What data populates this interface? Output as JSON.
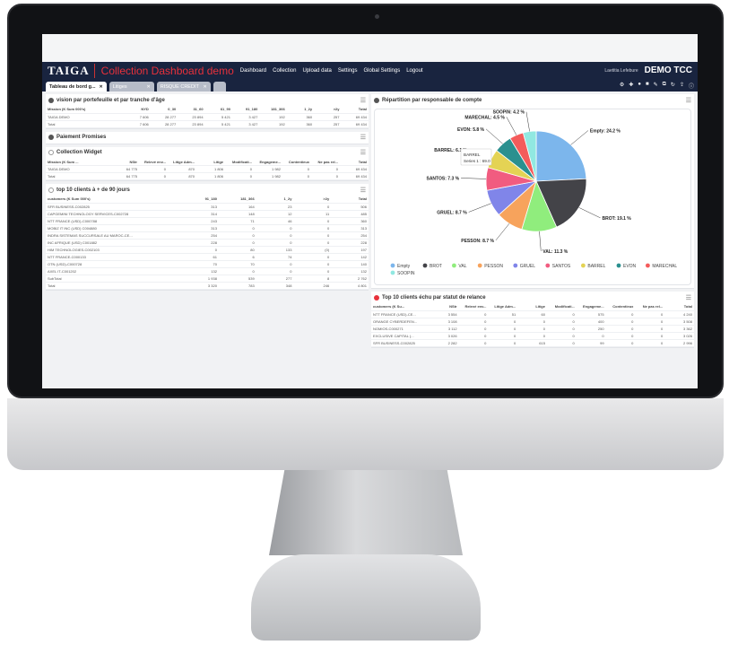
{
  "brand": "TAIGA",
  "app_title": "Collection Dashboard demo",
  "nav": [
    "Dashboard",
    "Collection",
    "Upload data",
    "Settings",
    "Global Settings",
    "Logout"
  ],
  "user": "Laetitia Lefebure",
  "company": "DEMO TCC",
  "tabs": [
    {
      "label": "Tableau de bord g...",
      "state": "active"
    },
    {
      "label": "Litiges",
      "state": "inactive"
    },
    {
      "label": "RISQUE CREDIT",
      "state": "inactive"
    }
  ],
  "colors": {
    "navy": "#19243f",
    "accent": "#e8313b"
  },
  "w1": {
    "title": "vision par portefeuille et par tranche d'âge",
    "headers": [
      "Mission (K Sum 000's)",
      "NYD",
      "0_30",
      "31_60",
      "61_90",
      "91_180",
      "181_366",
      "1_2y",
      ">2y",
      "Total"
    ],
    "rows": [
      [
        "TAIGA DEMO",
        "7 606",
        "28 277",
        "23 894",
        "5 421",
        "3 427",
        "192",
        "360",
        "257",
        "69 434"
      ],
      [
        "Total",
        "7 606",
        "28 277",
        "23 894",
        "5 421",
        "3 427",
        "192",
        "360",
        "257",
        "69 434"
      ]
    ]
  },
  "w2": {
    "title": "Paiement Promises"
  },
  "w3": {
    "title": "Collection Widget",
    "headers": [
      "Mission (K Sum ...",
      "NStr",
      "Relevé env...",
      "Litige Adm...",
      "Litige",
      "Modificati...",
      "Engageme...",
      "Contentieux",
      "Ne pas rel...",
      "Total"
    ],
    "rows": [
      [
        "TAIGA DEMO",
        "64 775",
        "0",
        "870",
        "1 806",
        "0",
        "1 982",
        "0",
        "0",
        "69 434"
      ],
      [
        "Total",
        "64 775",
        "0",
        "870",
        "1 806",
        "0",
        "1 982",
        "0",
        "0",
        "69 434"
      ]
    ]
  },
  "w4": {
    "title": "top 10 clients à + de 90 jours",
    "headers": [
      "customers (K Sum 000's)",
      "91_180",
      "181_366",
      "1_2y",
      ">2y",
      "Total"
    ],
    "rows": [
      [
        "SFR BUSINESS-C002825",
        "313",
        "164",
        "23",
        "0",
        "506"
      ],
      [
        "CAPGEMINI TECHNOLOGY SERVICES-C002728",
        "314",
        "148",
        "12",
        "11",
        "485"
      ],
      [
        "NTT FRANCE (USD)-C000788",
        "243",
        "71",
        "46",
        "0",
        "360"
      ],
      [
        "MOBIZ IT INC (USD) C004880",
        "313",
        "0",
        "0",
        "0",
        "313"
      ],
      [
        "INDRA SISTEMAS SUCCURSALE AU MAROC-CE...",
        "254",
        "0",
        "0",
        "0",
        "254"
      ],
      [
        "INC AFRIQUE (USD) C001882",
        "228",
        "0",
        "0",
        "0",
        "228"
      ],
      [
        "HIM TECHNOLOGIES-C002103",
        "0",
        "80",
        "133",
        "(0)",
        "197"
      ],
      [
        "NTT FRANCE-C000133",
        "61",
        "6",
        "74",
        "0",
        "142"
      ],
      [
        "OTN (USD)-C000728",
        "70",
        "70",
        "0",
        "0",
        "140"
      ],
      [
        "AXEL IT-C001202",
        "132",
        "0",
        "0",
        "0",
        "132"
      ],
      [
        "SubTotal",
        "1 938",
        "539",
        "277",
        "8",
        "2 762"
      ],
      [
        "Total",
        "3 320",
        "783",
        "348",
        "246",
        "4 801"
      ]
    ]
  },
  "w5": {
    "title": "Répartition par responsable de compte",
    "tooltip": {
      "name": "BARREL",
      "line": "Series 1 : 69.0"
    },
    "legend_title": ""
  },
  "chart_data": {
    "type": "pie",
    "title": "Répartition par responsable de compte",
    "slices": [
      {
        "label": "Empty",
        "percent": 24.2,
        "color": "#7cb6ec"
      },
      {
        "label": "BROT",
        "percent": 19.1,
        "color": "#434348"
      },
      {
        "label": "VAL",
        "percent": 11.3,
        "color": "#90ed7d"
      },
      {
        "label": "PESSON",
        "percent": 8.7,
        "color": "#f7a35c"
      },
      {
        "label": "GRUEL",
        "percent": 8.7,
        "color": "#8085e9"
      },
      {
        "label": "SANTOS",
        "percent": 7.3,
        "color": "#f15c80"
      },
      {
        "label": "BARREL",
        "percent": 6.1,
        "color": "#e4d354"
      },
      {
        "label": "EVON",
        "percent": 5.8,
        "color": "#2b908f"
      },
      {
        "label": "MARECHAL",
        "percent": 4.5,
        "color": "#f45b5b"
      },
      {
        "label": "SOOPIN",
        "percent": 4.2,
        "color": "#91e8e1"
      }
    ],
    "legend_placement": "bottom"
  },
  "w6": {
    "title": "Top 10 clients échu par statut de relance",
    "headers": [
      "customers (K Su...",
      "NStr",
      "Relevé env...",
      "Litige Adm...",
      "Litige",
      "Modificati...",
      "Engageme...",
      "Contentieux",
      "Ne pas rel...",
      "Total"
    ],
    "rows": [
      [
        "NTT FRANCE (USD)-CE...",
        "3 554",
        "0",
        "51",
        "60",
        "0",
        "575",
        "0",
        "0",
        "4 240"
      ],
      [
        "ORANGE CYBERDEFEN...",
        "3 108",
        "0",
        "0",
        "0",
        "0",
        "400",
        "0",
        "0",
        "3 508"
      ],
      [
        "NOMIOS-C000271",
        "3 112",
        "0",
        "0",
        "0",
        "0",
        "250",
        "0",
        "0",
        "3 362"
      ],
      [
        "EXCLUSIVE CAPITAL (...",
        "3 026",
        "0",
        "0",
        "0",
        "0",
        "0",
        "0",
        "0",
        "3 026"
      ],
      [
        "SFR BUSINESS-C002825",
        "2 282",
        "0",
        "0",
        "615",
        "0",
        "99",
        "0",
        "0",
        "2 996"
      ]
    ]
  }
}
